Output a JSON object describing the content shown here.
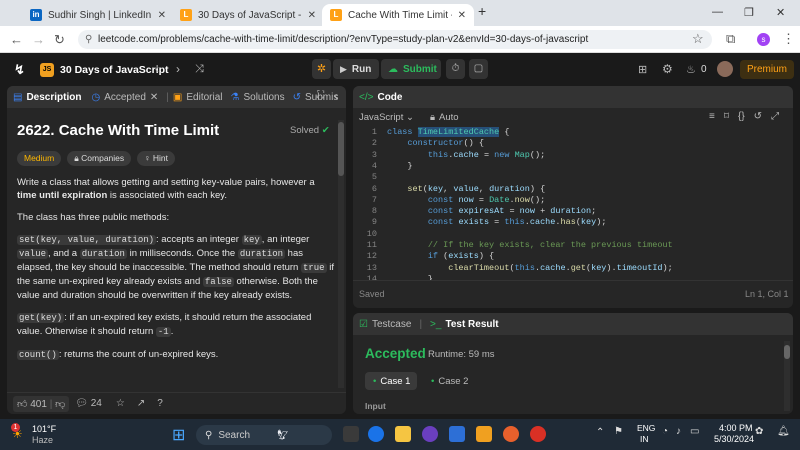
{
  "browser": {
    "tabs": [
      {
        "title": "Sudhir Singh | LinkedIn",
        "icon": "linkedin-icon",
        "color": "#0a66c2",
        "glyph": "in"
      },
      {
        "title": "30 Days of JavaScript - Study Pl",
        "icon": "leetcode-icon",
        "color": "#ffa116",
        "glyph": "L"
      },
      {
        "title": "Cache With Time Limit - LeetCo",
        "icon": "leetcode-icon",
        "color": "#ffa116",
        "glyph": "L"
      }
    ],
    "new_tab": "+",
    "close": "✕",
    "url": "leetcode.com/problems/cache-with-time-limit/description/?envType=study-plan-v2&envId=30-days-of-javascript",
    "profile": "s"
  },
  "lc": {
    "study_plan": "30 Days of JavaScript",
    "run": "Run",
    "submit": "Submit",
    "streak": "0",
    "premium": "Premium"
  },
  "desc": {
    "tabs": [
      "Description",
      "Accepted",
      "Editorial",
      "Solutions",
      "Submis"
    ],
    "title": "2622. Cache With Time Limit",
    "status": "Solved",
    "tags": [
      "Medium",
      "Companies",
      "Hint"
    ],
    "p1a": "Write a class that allows getting and setting key-value pairs, however a ",
    "p1b": "time until expiration",
    "p1c": " is associated with each key.",
    "p2": "The class has three public methods:",
    "m1_code": "set(key, value, duration)",
    "m1_t1": ": accepts an integer ",
    "m1_c2": "key",
    "m1_t2": ", an integer ",
    "m1_c3": "value",
    "m1_t3": ", and a ",
    "m1_c4": "duration",
    "m1_t4": " in milliseconds. Once the ",
    "m1_c5": "duration",
    "m1_t5": " has elapsed, the key should be inaccessible. The method should return ",
    "m1_c6": "true",
    "m1_t6": " if the same un-expired key already exists and ",
    "m1_c7": "false",
    "m1_t7": " otherwise. Both the value and duration should be overwritten if the key already exists.",
    "m2_code": "get(key)",
    "m2_t1": ": if an un-expired key exists, it should return the associated value. Otherwise it should return ",
    "m2_c2": "-1",
    "m2_t2": ".",
    "m3_code": "count()",
    "m3_t1": ": returns the count of un-expired keys.",
    "likes": "401",
    "comments": "24"
  },
  "code": {
    "header": "Code",
    "language": "JavaScript",
    "auto": "Auto",
    "saved": "Saved",
    "cursor": "Ln 1, Col 1",
    "lines": [
      "1",
      "2",
      "3",
      "4",
      "5",
      "6",
      "7",
      "8",
      "9",
      "10",
      "11",
      "12",
      "13",
      "14"
    ]
  },
  "result": {
    "tabs": [
      "Testcase",
      "Test Result"
    ],
    "status": "Accepted",
    "runtime": "Runtime: 59 ms",
    "cases": [
      "Case 1",
      "Case 2"
    ],
    "input_label": "Input"
  },
  "taskbar": {
    "temp": "101°F",
    "weather": "Haze",
    "badge": "1",
    "search": "Search",
    "lang1": "ENG",
    "lang2": "IN",
    "time": "4:00 PM",
    "date": "5/30/2024"
  }
}
